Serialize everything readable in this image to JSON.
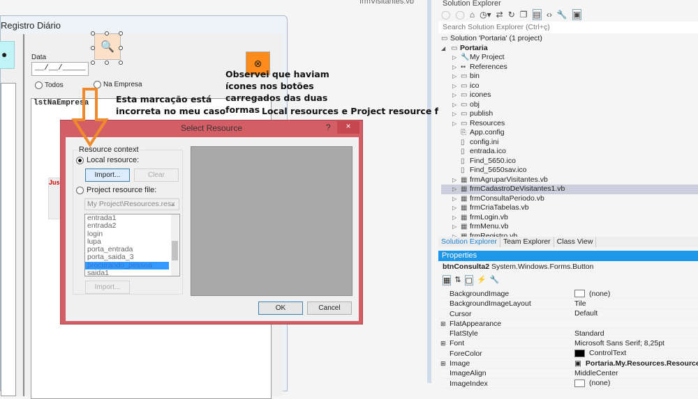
{
  "document_tab": "frmVisitantes.vb",
  "form": {
    "title": "Registro Diário",
    "date_label": "Data",
    "date_value": "__/__/_____",
    "radio_all": "Todos",
    "radio_in_company": "Na Empresa",
    "list_name": "lstNaEmpresa",
    "hidden_label": "Jus"
  },
  "annotations": {
    "note1": [
      "Esta marcação está",
      "incorreta no meu caso"
    ],
    "note2": [
      "Observei que haviam",
      "ícones nos botões",
      "carregados das duas",
      "formas"
    ],
    "note3": "Local resources e Project resource files",
    "arrow_color": "#f08a2c"
  },
  "dialog": {
    "title": "Select Resource",
    "help": "?",
    "close": "×",
    "group_label": "Resource context",
    "local_resource": "Local resource:",
    "local_selected": true,
    "import_label": "Import...",
    "clear_label": "Clear",
    "project_resource": "Project resource file:",
    "resx_file": "My Project\\Resources.resx",
    "resources": [
      "entrada1",
      "entrada2",
      "login",
      "lupa",
      "porta_entrada",
      "porta_saida_3",
      "procurando_pessoa",
      "saida1"
    ],
    "selected_resource": "procurando_pessoa",
    "import2_label": "Import...",
    "ok": "OK",
    "cancel": "Cancel"
  },
  "solution_explorer": {
    "title": "Solution Explorer",
    "search_placeholder": "Search Solution Explorer (Ctrl+ç)",
    "solution": "Solution 'Portaria' (1 project)",
    "project": "Portaria",
    "items": [
      {
        "label": "My Project",
        "icon": "wrench-icon",
        "expandable": true
      },
      {
        "label": "References",
        "icon": "references-icon",
        "expandable": true
      },
      {
        "label": "bin",
        "icon": "folder-icon",
        "expandable": true
      },
      {
        "label": "ico",
        "icon": "folder-icon",
        "expandable": true
      },
      {
        "label": "icones",
        "icon": "folder-icon",
        "expandable": true
      },
      {
        "label": "obj",
        "icon": "folder-icon",
        "expandable": true
      },
      {
        "label": "publish",
        "icon": "folder-icon",
        "expandable": true
      },
      {
        "label": "Resources",
        "icon": "folder-icon",
        "expandable": true
      },
      {
        "label": "App.config",
        "icon": "config-icon",
        "expandable": false
      },
      {
        "label": "config.ini",
        "icon": "file-icon",
        "expandable": false
      },
      {
        "label": "entrada.ico",
        "icon": "file-icon",
        "expandable": false
      },
      {
        "label": "Find_5650.ico",
        "icon": "file-icon",
        "expandable": false
      },
      {
        "label": "Find_5650sav.ico",
        "icon": "file-icon",
        "expandable": false
      },
      {
        "label": "frmAgruparVisitantes.vb",
        "icon": "form-icon",
        "expandable": true
      },
      {
        "label": "frmCadastroDeVisitantes1.vb",
        "icon": "form-icon",
        "expandable": true,
        "selected": true
      },
      {
        "label": "frmConsultaPeriodo.vb",
        "icon": "form-icon",
        "expandable": true
      },
      {
        "label": "frmCriaTabelas.vb",
        "icon": "form-icon",
        "expandable": true
      },
      {
        "label": "frmLogin.vb",
        "icon": "form-icon",
        "expandable": true
      },
      {
        "label": "frmMenu.vb",
        "icon": "form-icon",
        "expandable": true
      },
      {
        "label": "frmRegistro.vb",
        "icon": "form-icon",
        "expandable": true
      }
    ],
    "tabs": [
      "Solution Explorer",
      "Team Explorer",
      "Class View"
    ]
  },
  "properties": {
    "title": "Properties",
    "object_name": "btnConsulta2",
    "object_type": "System.Windows.Forms.Button",
    "rows": [
      {
        "name": "BackgroundImage",
        "value": "(none)",
        "swatch": "#ffffff"
      },
      {
        "name": "BackgroundImageLayout",
        "value": "Tile"
      },
      {
        "name": "Cursor",
        "value": "Default"
      },
      {
        "name": "FlatAppearance",
        "value": "",
        "expandable": true
      },
      {
        "name": "FlatStyle",
        "value": "Standard"
      },
      {
        "name": "Font",
        "value": "Microsoft Sans Serif; 8,25pt",
        "expandable": true
      },
      {
        "name": "ForeColor",
        "value": "ControlText",
        "swatch": "#000000"
      },
      {
        "name": "Image",
        "value": "Portaria.My.Resources.Resources.pro",
        "expandable": true,
        "bold": true
      },
      {
        "name": "ImageAlign",
        "value": "MiddleCenter"
      },
      {
        "name": "ImageIndex",
        "value": "(none)",
        "swatch": "#ffffff"
      }
    ]
  }
}
